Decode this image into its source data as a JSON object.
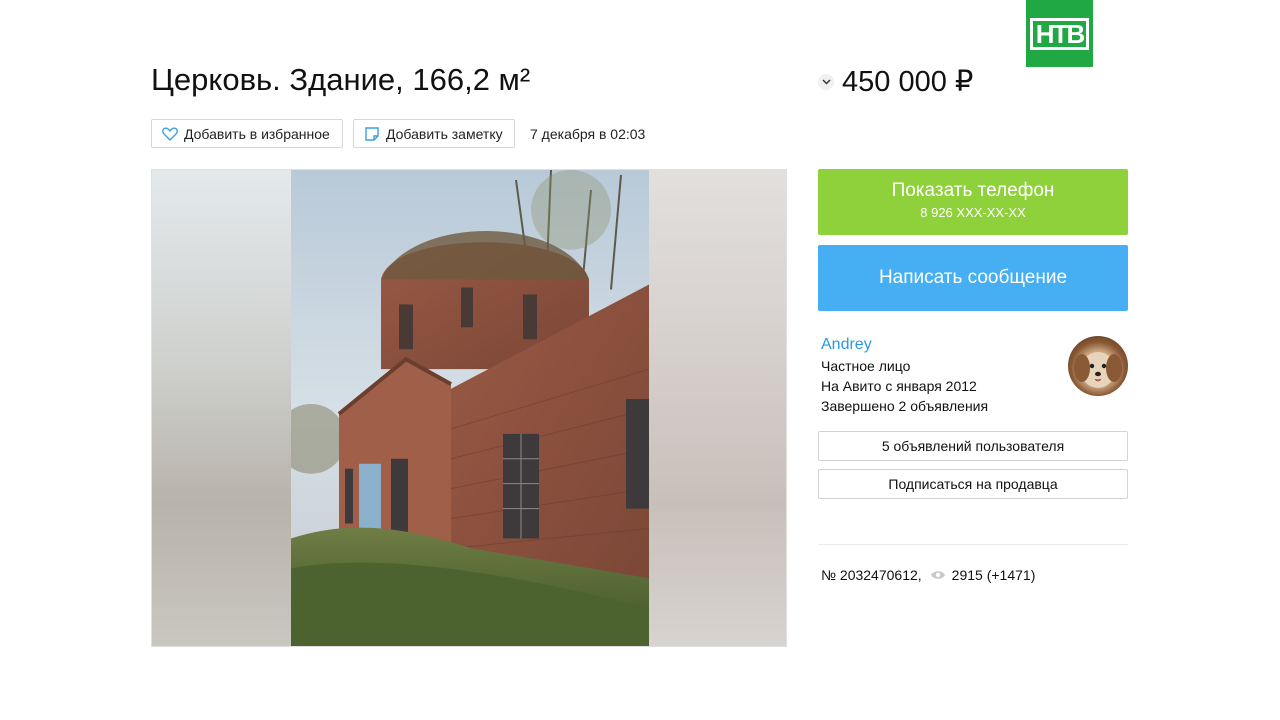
{
  "logo": {
    "text": "НТВ"
  },
  "listing": {
    "title": "Церковь. Здание, 166,2 м²",
    "price": "450 000 ₽",
    "date": "7 декабря в 02:03",
    "favorite_label": "Добавить в избранное",
    "note_label": "Добавить заметку",
    "number": "№ 2032470612,",
    "views": "2915 (+1471)"
  },
  "contact": {
    "show_phone_label": "Показать телефон",
    "phone": "8 926 XXX-XX-XX",
    "message_label": "Написать сообщение"
  },
  "seller": {
    "name": "Andrey",
    "type": "Частное лицо",
    "since": "На Авито с января 2012",
    "completed": "Завершено 2 объявления",
    "ads_button": "5 объявлений пользователя",
    "subscribe_button": "Подписаться на продавца"
  },
  "icons": {
    "favorite": "heart-icon",
    "note": "note-icon",
    "price_toggle": "chevron-down-icon",
    "views": "eye-icon"
  },
  "colors": {
    "phone_button": "#8fd13b",
    "message_button": "#46aef2",
    "seller_link": "#2a9ae0",
    "logo_bg": "#1fa843"
  }
}
